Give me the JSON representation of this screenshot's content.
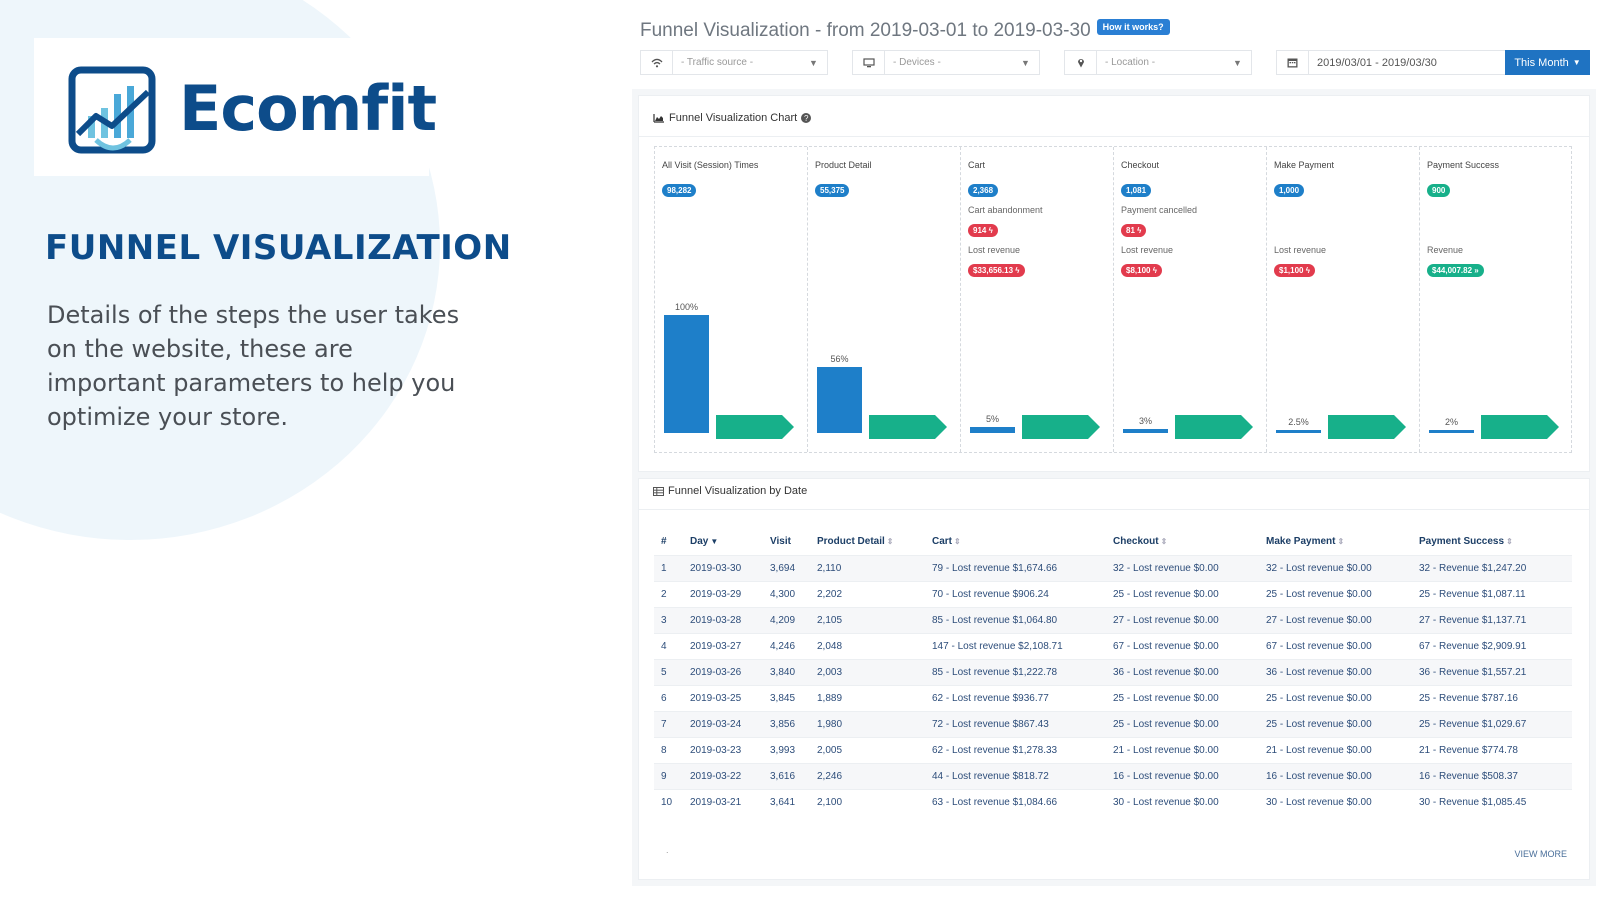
{
  "brand": {
    "name": "Ecomfit"
  },
  "hero": {
    "headline": "FUNNEL VISUALIZATION",
    "description": "Details of the steps the user takes on the website, these are important parameters to help you optimize your store."
  },
  "header": {
    "title": "Funnel Visualization - from 2019-03-01 to 2019-03-30",
    "help_badge": "How it works?"
  },
  "filters": {
    "traffic_source": "- Traffic source -",
    "devices": "- Devices -",
    "location": "- Location -",
    "date_range": "2019/03/01 - 2019/03/30",
    "range_button": "This Month"
  },
  "chart_card": {
    "title": "Funnel Visualization Chart"
  },
  "chart_data": {
    "type": "bar",
    "categories": [
      "All Visit (Session) Times",
      "Product Detail",
      "Cart",
      "Checkout",
      "Make Payment",
      "Payment Success"
    ],
    "counts": [
      "98,282",
      "55,375",
      "2,368",
      "1,081",
      "1,000",
      "900"
    ],
    "percent_labels": [
      "100%",
      "56%",
      "5%",
      "3%",
      "2.5%",
      "2%"
    ],
    "values": [
      100,
      56,
      5,
      3,
      2.5,
      2
    ],
    "ylim": [
      0,
      100
    ],
    "metrics": {
      "cart_abandonment_label": "Cart abandonment",
      "cart_abandonment": "914",
      "cart_lost_label": "Lost revenue",
      "cart_lost": "$33,656.13",
      "checkout_cancel_label": "Payment cancelled",
      "checkout_cancel": "81",
      "checkout_lost_label": "Lost revenue",
      "checkout_lost": "$8,100",
      "payment_lost_label": "Lost revenue",
      "payment_lost": "$1,100",
      "success_revenue_label": "Revenue",
      "success_revenue": "$44,007.82"
    }
  },
  "table_card": {
    "title": "Funnel Visualization by Date",
    "columns": [
      "#",
      "Day",
      "Visit",
      "Product Detail",
      "Cart",
      "Checkout",
      "Make Payment",
      "Payment Success"
    ],
    "rows": [
      [
        "1",
        "2019-03-30",
        "3,694",
        "2,110",
        "79 - Lost revenue $1,674.66",
        "32 - Lost revenue $0.00",
        "32 - Lost revenue $0.00",
        "32 - Revenue $1,247.20"
      ],
      [
        "2",
        "2019-03-29",
        "4,300",
        "2,202",
        "70 - Lost revenue $906.24",
        "25 - Lost revenue $0.00",
        "25 - Lost revenue $0.00",
        "25 - Revenue $1,087.11"
      ],
      [
        "3",
        "2019-03-28",
        "4,209",
        "2,105",
        "85 - Lost revenue $1,064.80",
        "27 - Lost revenue $0.00",
        "27 - Lost revenue $0.00",
        "27 - Revenue $1,137.71"
      ],
      [
        "4",
        "2019-03-27",
        "4,246",
        "2,048",
        "147 - Lost revenue $2,108.71",
        "67 - Lost revenue $0.00",
        "67 - Lost revenue $0.00",
        "67 - Revenue $2,909.91"
      ],
      [
        "5",
        "2019-03-26",
        "3,840",
        "2,003",
        "85 - Lost revenue $1,222.78",
        "36 - Lost revenue $0.00",
        "36 - Lost revenue $0.00",
        "36 - Revenue $1,557.21"
      ],
      [
        "6",
        "2019-03-25",
        "3,845",
        "1,889",
        "62 - Lost revenue $936.77",
        "25 - Lost revenue $0.00",
        "25 - Lost revenue $0.00",
        "25 - Revenue $787.16"
      ],
      [
        "7",
        "2019-03-24",
        "3,856",
        "1,980",
        "72 - Lost revenue $867.43",
        "25 - Lost revenue $0.00",
        "25 - Lost revenue $0.00",
        "25 - Revenue $1,029.67"
      ],
      [
        "8",
        "2019-03-23",
        "3,993",
        "2,005",
        "62 - Lost revenue $1,278.33",
        "21 - Lost revenue $0.00",
        "21 - Lost revenue $0.00",
        "21 - Revenue $774.78"
      ],
      [
        "9",
        "2019-03-22",
        "3,616",
        "2,246",
        "44 - Lost revenue $818.72",
        "16 - Lost revenue $0.00",
        "16 - Lost revenue $0.00",
        "16 - Revenue $508.37"
      ],
      [
        "10",
        "2019-03-21",
        "3,641",
        "2,100",
        "63 - Lost revenue $1,084.66",
        "30 - Lost revenue $0.00",
        "30 - Lost revenue $0.00",
        "30 - Revenue $1,085.45"
      ]
    ],
    "view_more": "VIEW MORE",
    "footer_dot": "."
  },
  "colors": {
    "brand": "#0d4c8a",
    "bar": "#1e7fc9",
    "arrow": "#17b08a",
    "danger": "#e23b4d",
    "button": "#1f73c2"
  },
  "icons": [
    "wifi-icon",
    "monitor-icon",
    "map-pin-icon",
    "calendar-icon",
    "area-chart-icon",
    "question-icon",
    "table-icon"
  ]
}
